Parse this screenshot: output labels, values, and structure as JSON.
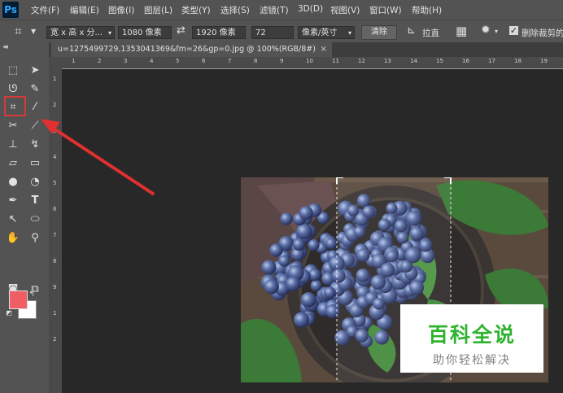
{
  "app": {
    "logo": "Ps"
  },
  "menu": [
    "文件(F)",
    "编辑(E)",
    "图像(I)",
    "图层(L)",
    "类型(Y)",
    "选择(S)",
    "滤镜(T)",
    "3D(D)",
    "视图(V)",
    "窗口(W)",
    "帮助(H)"
  ],
  "options": {
    "preset": "宽 x 高 x 分...",
    "width": "1080 像素",
    "height": "1920 像素",
    "resolution": "72",
    "unit": "像素/英寸",
    "clear_label": "清除",
    "straighten_label": "拉直",
    "delete_cropped_label": "删除裁剪的"
  },
  "document": {
    "tab_title": "u=1275499729,1353041369&fm=26&gp=0.jpg @ 100%(RGB/8#)"
  },
  "ruler": {
    "top_marks": [
      "1",
      "2",
      "3",
      "4",
      "5",
      "6",
      "7",
      "8",
      "9",
      "10",
      "11",
      "12",
      "13",
      "14",
      "15",
      "16",
      "17",
      "18",
      "19"
    ],
    "left_marks": [
      "1",
      "2",
      "3",
      "4",
      "5",
      "6",
      "7",
      "8",
      "9",
      "1",
      "2"
    ]
  },
  "colors": {
    "foreground": "#ee5e64",
    "background": "#ffffff",
    "highlight": "#d53a3a"
  },
  "watermark": {
    "title": "百科全说",
    "subtitle": "助你轻松解决"
  }
}
